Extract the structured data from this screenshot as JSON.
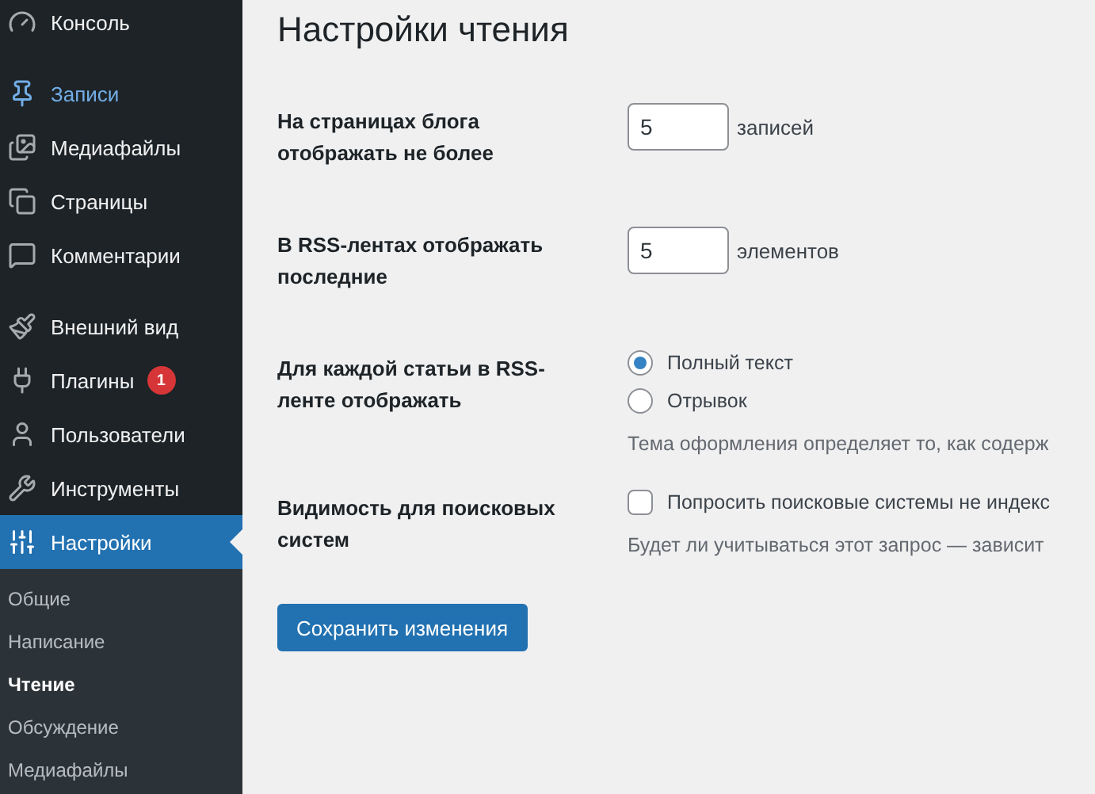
{
  "sidebar": {
    "groups": [
      {
        "items": [
          {
            "label": "Консоль",
            "selected": false,
            "highlighted": false
          }
        ]
      },
      {
        "items": [
          {
            "label": "Записи",
            "selected": false,
            "highlighted": true
          },
          {
            "label": "Медиафайлы",
            "selected": false,
            "highlighted": false
          },
          {
            "label": "Страницы",
            "selected": false,
            "highlighted": false
          },
          {
            "label": "Комментарии",
            "selected": false,
            "highlighted": false
          }
        ]
      },
      {
        "items": [
          {
            "label": "Внешний вид",
            "selected": false,
            "highlighted": false
          },
          {
            "label": "Плагины",
            "selected": false,
            "highlighted": false,
            "badge": "1"
          },
          {
            "label": "Пользователи",
            "selected": false,
            "highlighted": false
          },
          {
            "label": "Инструменты",
            "selected": false,
            "highlighted": false
          },
          {
            "label": "Настройки",
            "selected": true,
            "highlighted": false
          }
        ]
      }
    ],
    "submenu": [
      {
        "label": "Общие",
        "selected": false
      },
      {
        "label": "Написание",
        "selected": false
      },
      {
        "label": "Чтение",
        "selected": true
      },
      {
        "label": "Обсуждение",
        "selected": false
      },
      {
        "label": "Медиафайлы",
        "selected": false
      }
    ]
  },
  "page_title": "Настройки чтения",
  "rows": [
    {
      "kind": "number",
      "label": "На страницах блога отображать не более",
      "value": "5",
      "unit": "записей"
    },
    {
      "kind": "number",
      "label": "В RSS-лентах отображать последние",
      "value": "5",
      "unit": "элементов"
    },
    {
      "kind": "radio",
      "label": "Для каждой статьи в RSS-ленте отображать",
      "options": [
        {
          "label": "Полный текст",
          "selected": true
        },
        {
          "label": "Отрывок",
          "selected": false
        }
      ],
      "description": "Тема оформления определяет то, как содерж"
    },
    {
      "kind": "checkbox",
      "label": "Видимость для поисковых систем",
      "option": {
        "label": "Попросить поисковые системы не индекс",
        "checked": false
      },
      "description": "Будет ли учитываться этот запрос — зависит"
    }
  ],
  "save_button": "Сохранить изменения"
}
